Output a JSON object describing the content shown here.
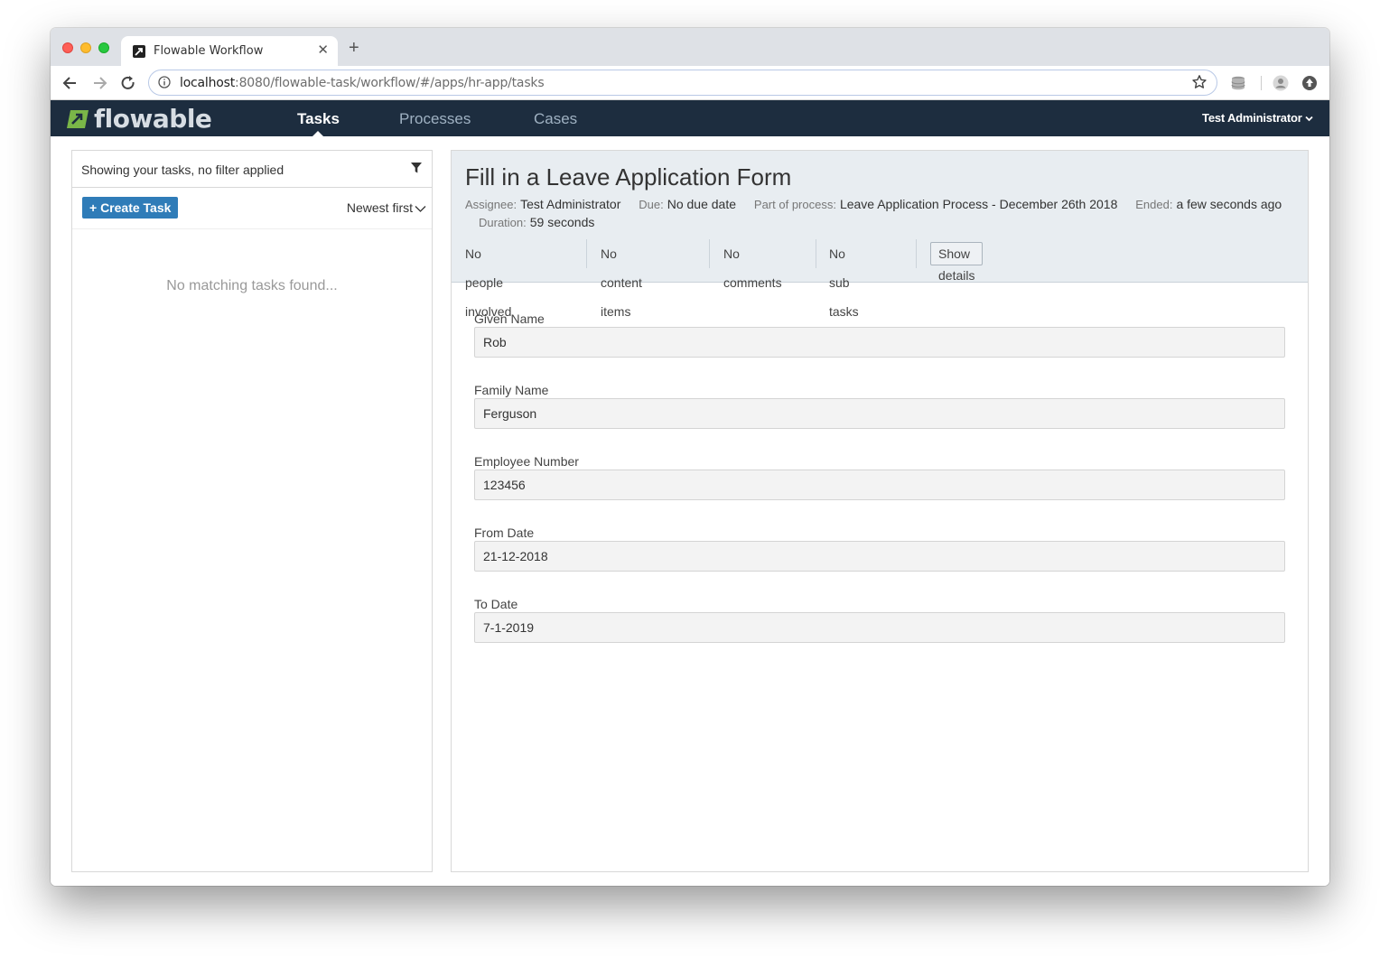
{
  "browser": {
    "tab_title": "Flowable Workflow",
    "url_host": "localhost",
    "url_path": ":8080/flowable-task/workflow/#/apps/hr-app/tasks"
  },
  "app": {
    "logo_text": "flowable",
    "nav": [
      {
        "label": "Tasks",
        "active": true
      },
      {
        "label": "Processes",
        "active": false
      },
      {
        "label": "Cases",
        "active": false
      }
    ],
    "user": "Test Administrator",
    "colors": {
      "navbar": "#1d2d3f",
      "accent": "#2f7cb8",
      "logo_green": "#7ab648"
    }
  },
  "task_list": {
    "filter_text": "Showing your tasks, no filter applied",
    "create_label": "+ Create Task",
    "sort_label": "Newest first",
    "empty_text": "No matching tasks found..."
  },
  "task": {
    "title": "Fill in a Leave Application Form",
    "assignee_label": "Assignee:",
    "assignee": "Test Administrator",
    "due_label": "Due:",
    "due": "No due date",
    "process_label": "Part of process:",
    "process": "Leave Application Process - December 26th 2018",
    "ended_label": "Ended:",
    "ended": "a few seconds ago",
    "duration_label": "Duration:",
    "duration": "59 seconds",
    "sections": {
      "people": "No people involved",
      "content": "No content items",
      "comments": "No comments",
      "subtasks": "No sub tasks",
      "show_details": "Show details"
    }
  },
  "form": {
    "fields": [
      {
        "label": "Given Name",
        "value": "Rob"
      },
      {
        "label": "Family Name",
        "value": "Ferguson"
      },
      {
        "label": "Employee Number",
        "value": "123456"
      },
      {
        "label": "From Date",
        "value": "21-12-2018"
      },
      {
        "label": "To Date",
        "value": "7-1-2019"
      }
    ]
  }
}
